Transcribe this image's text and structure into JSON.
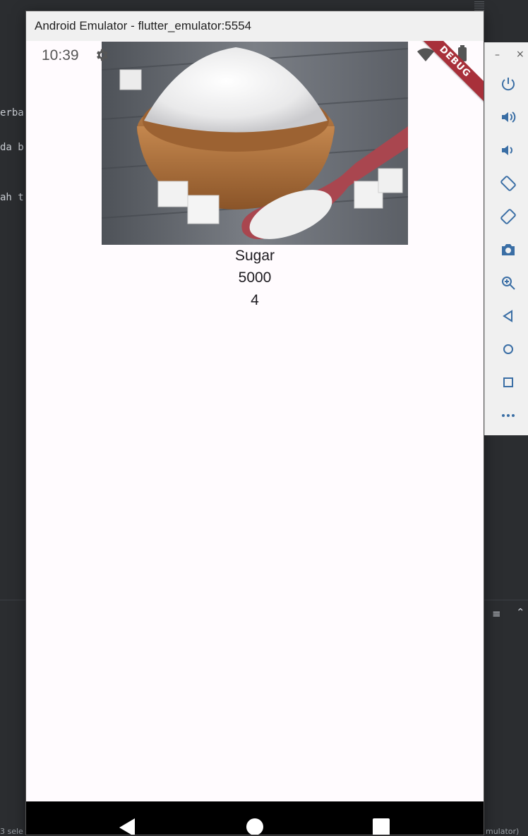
{
  "ide": {
    "code_lines": [
      "erba",
      "da b",
      "ah t"
    ],
    "status_left": "3 sele",
    "status_right": "mulator)"
  },
  "emulator": {
    "window_title": "Android Emulator - flutter_emulator:5554",
    "debug_banner": "DEBUG",
    "toolbar": {
      "minimize": "–",
      "close": "×"
    },
    "toolbar_buttons": [
      "power",
      "volume-up",
      "volume-down",
      "rotate-left",
      "rotate-right",
      "camera",
      "zoom",
      "back",
      "home",
      "overview",
      "more"
    ]
  },
  "phone": {
    "status": {
      "time": "10:39"
    },
    "product": {
      "name": "Sugar",
      "price": "5000",
      "quantity": "4"
    }
  },
  "colors": {
    "app_background": "#fffbfe",
    "debug_banner": "#a8303a",
    "ide_background": "#2b2d30"
  }
}
